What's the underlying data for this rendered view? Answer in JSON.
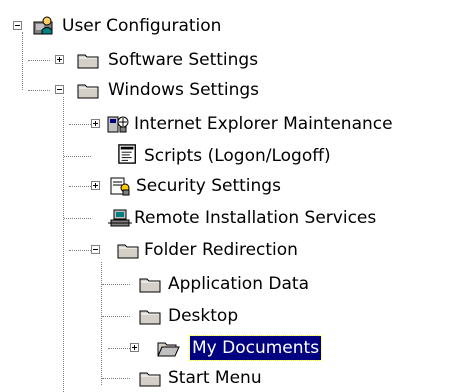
{
  "tree": {
    "root": {
      "label": "User Configuration",
      "icon": "user-config-icon",
      "expander": "minus"
    },
    "software_settings": {
      "label": "Software Settings",
      "icon": "folder-icon",
      "expander": "plus"
    },
    "windows_settings": {
      "label": "Windows Settings",
      "icon": "folder-icon",
      "expander": "minus"
    },
    "ie_maintenance": {
      "label": "Internet Explorer Maintenance",
      "icon": "ie-maintenance-icon",
      "expander": "plus"
    },
    "scripts": {
      "label": "Scripts (Logon/Logoff)",
      "icon": "scripts-icon"
    },
    "security_settings": {
      "label": "Security Settings",
      "icon": "security-icon",
      "expander": "plus"
    },
    "remote_install": {
      "label": "Remote Installation Services",
      "icon": "remote-install-icon"
    },
    "folder_redirection": {
      "label": "Folder Redirection",
      "icon": "folder-icon",
      "expander": "minus"
    },
    "application_data": {
      "label": "Application Data",
      "icon": "folder-icon"
    },
    "desktop": {
      "label": "Desktop",
      "icon": "folder-icon"
    },
    "my_documents": {
      "label": "My Documents",
      "icon": "open-folder-icon",
      "expander": "plus",
      "selected": true
    },
    "start_menu": {
      "label": "Start Menu",
      "icon": "folder-icon"
    }
  },
  "colors": {
    "selection_bg": "#000080",
    "selection_text": "#ffffff",
    "folder": "#d4d0c8"
  }
}
